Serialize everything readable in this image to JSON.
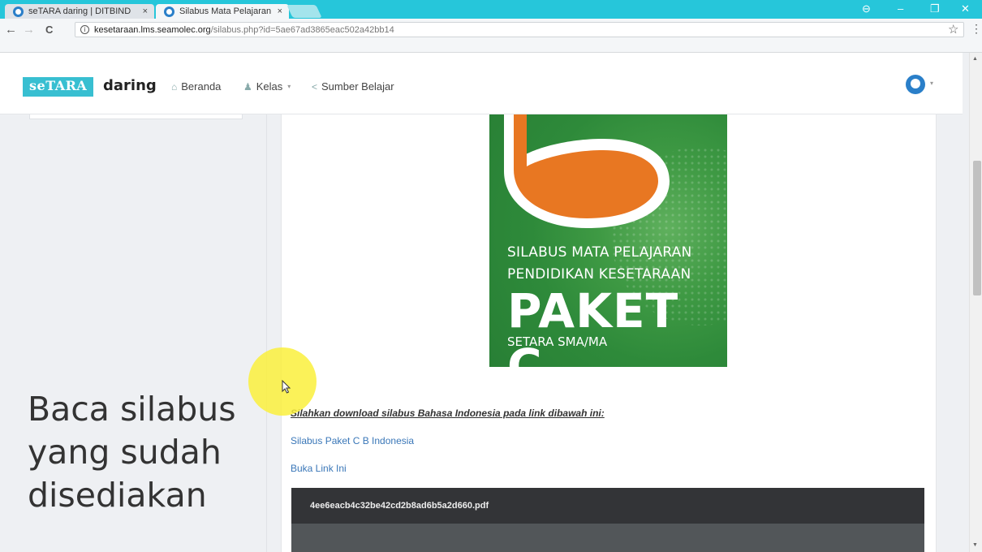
{
  "browser": {
    "tabs": [
      {
        "title": "seTARA daring | DITBIND",
        "close": "×"
      },
      {
        "title": "Silabus Mata Pelajaran B",
        "close": "×"
      }
    ],
    "window_controls": {
      "profile": "⊖",
      "minimize": "–",
      "restore": "❐",
      "close": "✕"
    },
    "nav": {
      "back": "←",
      "forward": "→",
      "reload": "C"
    },
    "address": {
      "info": "i",
      "host": "kesetaraan.lms.seamolec.org",
      "path": "/silabus.php?id=5ae67ad3865eac502a42bb14"
    },
    "star": "☆",
    "menu": "⋮"
  },
  "site": {
    "logo": {
      "box": "seTARA",
      "word": "daring"
    },
    "menu": [
      {
        "icon": "home-icon",
        "glyph": "⌂",
        "label": "Beranda"
      },
      {
        "icon": "users-icon",
        "glyph": "♟",
        "label": "Kelas",
        "caret": "▾"
      },
      {
        "icon": "share-icon",
        "glyph": "<",
        "label": "Sumber Belajar"
      }
    ],
    "user_caret": "▾"
  },
  "cover": {
    "line1": "SILABUS MATA PELAJARAN",
    "line2": "PENDIDIKAN KESETARAAN",
    "line3": "PAKET C",
    "line4": "SETARA SMA/MA",
    "colors": {
      "green": "#2e8a3a",
      "orange": "#e87722"
    }
  },
  "content": {
    "instruction": "Silahkan download silabus Bahasa Indonesia pada link dibawah ini:",
    "link1": "Silabus Paket C B Indonesia",
    "link2": "Buka Link Ini",
    "pdf_filename": "4ee6eacb4c32be42cd2b8ad6b5a2d660.pdf"
  },
  "overlay": {
    "line1": "Baca silabus",
    "line2": "yang sudah",
    "line3": "disediakan"
  },
  "scrollbar": {
    "up": "▲",
    "down": "▼"
  }
}
